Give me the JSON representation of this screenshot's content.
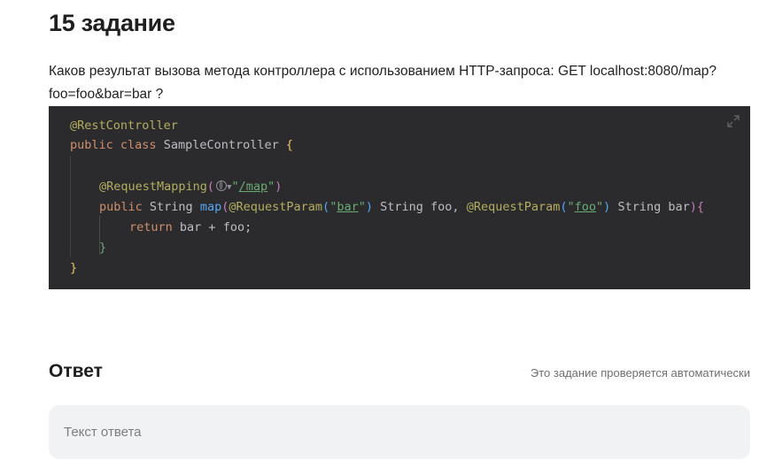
{
  "task": {
    "title": "15 задание",
    "question": "Каков результат вызова метода контроллера с использованием HTTP-запроса: GET localhost:8080/map?foo=foo&bar=bar ?"
  },
  "code": {
    "line1": "@RestController",
    "line2_kw1": "public",
    "line2_kw2": "class",
    "line2_name": "SampleController",
    "line2_brace": "{",
    "line3_ann": "@RequestMapping",
    "line3_open": "(",
    "line3_q1": "\"",
    "line3_path": "/map",
    "line3_q2": "\"",
    "line3_close": ")",
    "line4_kw": "public",
    "line4_type": "String",
    "line4_fn": "map",
    "line4_open": "(",
    "line4_ann1": "@RequestParam",
    "line4_p1open": "(",
    "line4_s1q1": "\"",
    "line4_s1": "bar",
    "line4_s1q2": "\"",
    "line4_p1close": ")",
    "line4_arg1": "String foo,",
    "line4_ann2": "@RequestParam",
    "line4_p2open": "(",
    "line4_s2q1": "\"",
    "line4_s2": "foo",
    "line4_s2q2": "\"",
    "line4_p2close": ")",
    "line4_arg2": "String bar",
    "line4_close": ")",
    "line4_brace": "{",
    "line5_kw": "return",
    "line5_expr": "bar + foo;",
    "line6": "}",
    "line7": "}"
  },
  "answer": {
    "title": "Ответ",
    "note": "Это задание проверяется автоматически",
    "placeholder": "Текст ответа",
    "value": ""
  },
  "icons": {
    "expand": "expand-icon",
    "globe": "globe-icon"
  }
}
